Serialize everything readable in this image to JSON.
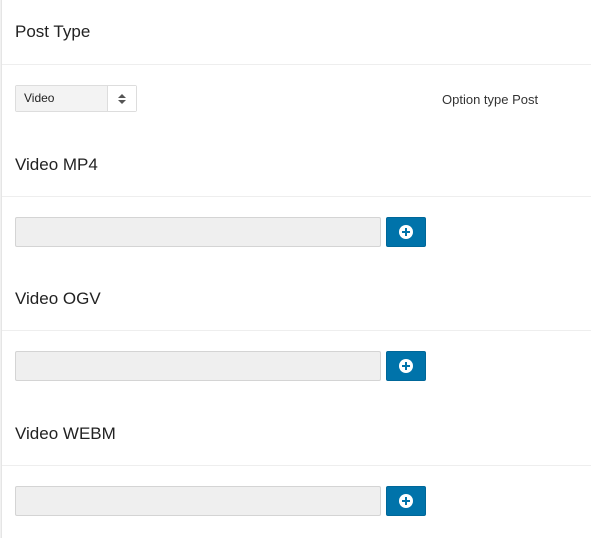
{
  "post_type": {
    "title": "Post Type",
    "select_value": "Video",
    "description": "Option type Post"
  },
  "fields": [
    {
      "label": "Video MP4",
      "value": "",
      "button_icon": "plus-circle-icon"
    },
    {
      "label": "Video OGV",
      "value": "",
      "button_icon": "plus-circle-icon"
    },
    {
      "label": "Video WEBM",
      "value": "",
      "button_icon": "plus-circle-icon"
    }
  ],
  "colors": {
    "accent": "#0073aa",
    "input_bg": "#efefef",
    "divider": "#eeeeee"
  }
}
